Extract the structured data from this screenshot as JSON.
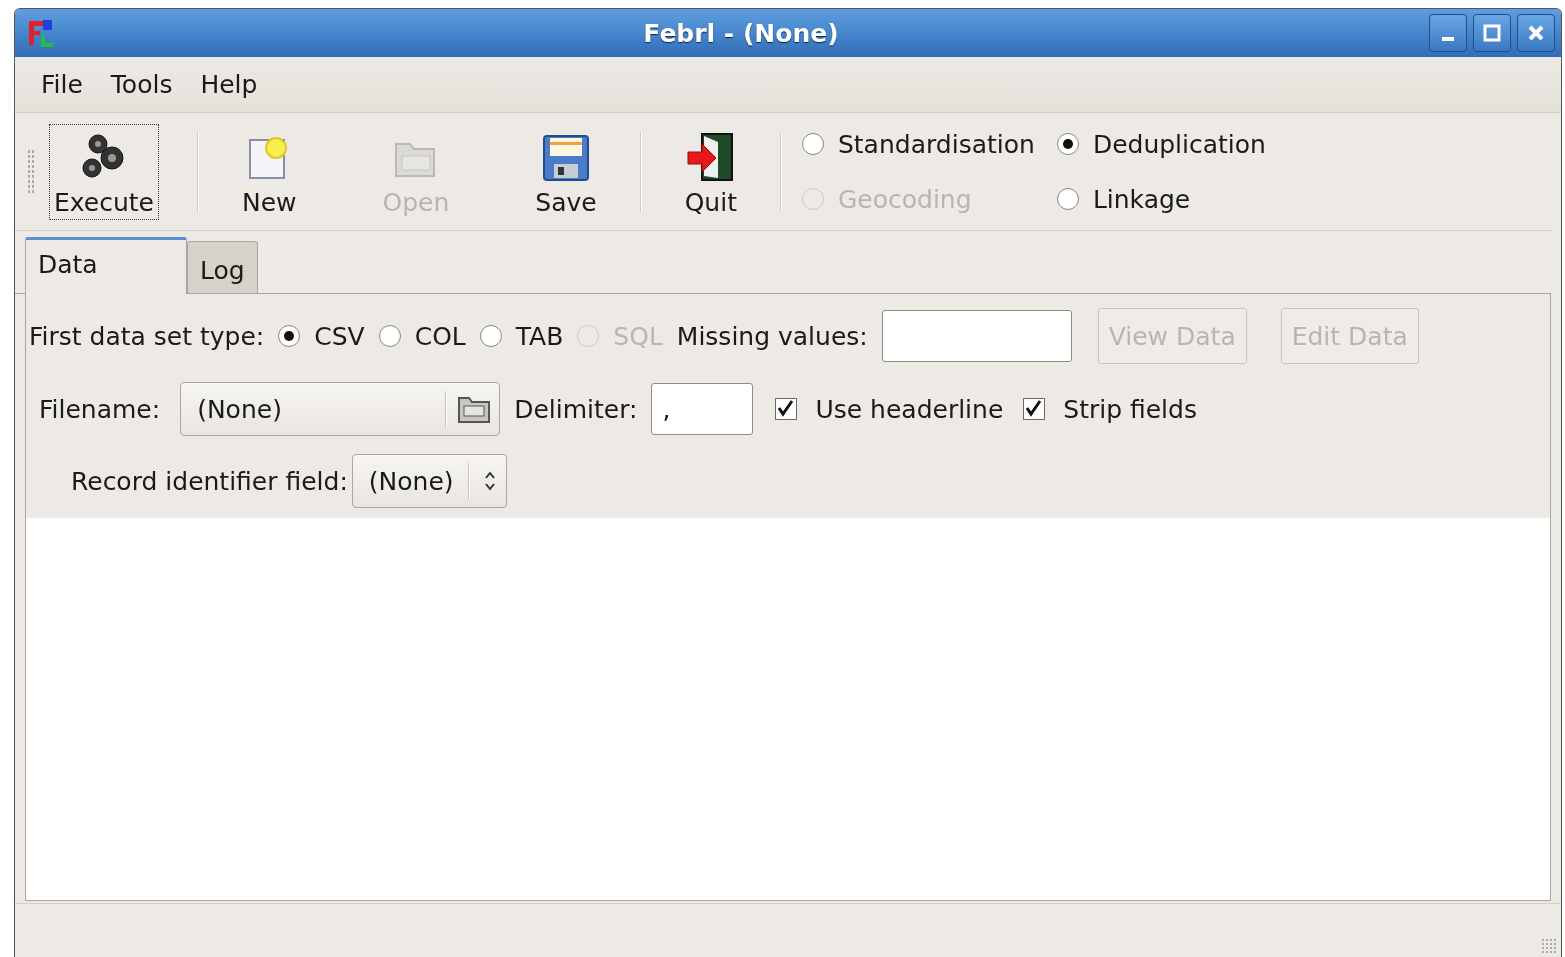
{
  "window": {
    "title": "Febrl - (None)"
  },
  "menu": [
    {
      "label": "File"
    },
    {
      "label": "Tools"
    },
    {
      "label": "Help"
    }
  ],
  "toolbar": {
    "buttons": [
      {
        "kind": "execute",
        "label": "Execute",
        "disabled": false,
        "focused": true
      },
      {
        "kind": "separator"
      },
      {
        "kind": "new",
        "label": "New",
        "disabled": false,
        "focused": false
      },
      {
        "kind": "open",
        "label": "Open",
        "disabled": true,
        "focused": false
      },
      {
        "kind": "save",
        "label": "Save",
        "disabled": false,
        "focused": false
      },
      {
        "kind": "separator"
      },
      {
        "kind": "quit",
        "label": "Quit",
        "disabled": false,
        "focused": false
      },
      {
        "kind": "separator"
      }
    ],
    "modes": [
      {
        "label": "Standardisation",
        "selected": false,
        "disabled": false
      },
      {
        "label": "Deduplication",
        "selected": true,
        "disabled": false
      },
      {
        "label": "Geocoding",
        "selected": false,
        "disabled": true
      },
      {
        "label": "Linkage",
        "selected": false,
        "disabled": false
      }
    ]
  },
  "tabs": [
    {
      "label": "Data",
      "selected": true
    },
    {
      "label": "Log",
      "selected": false
    }
  ],
  "data": {
    "type_label": "First data set type:",
    "types": [
      {
        "label": "CSV",
        "selected": true,
        "disabled": false
      },
      {
        "label": "COL",
        "selected": false,
        "disabled": false
      },
      {
        "label": "TAB",
        "selected": false,
        "disabled": false
      },
      {
        "label": "SQL",
        "selected": false,
        "disabled": true
      }
    ],
    "missing_label": "Missing values:",
    "buttons": [
      {
        "label": "View Data",
        "disabled": true
      },
      {
        "label": "Edit Data",
        "disabled": true
      }
    ],
    "filename_label": "Filename:",
    "filename": "(None)",
    "delimiter_label": "Delimiter:",
    "delimiter": ",",
    "checks": [
      {
        "label": "Use headerline",
        "checked": true
      },
      {
        "label": "Strip fields",
        "checked": true
      }
    ],
    "record_label": "Record identifier field:",
    "record_value": "(None)"
  }
}
